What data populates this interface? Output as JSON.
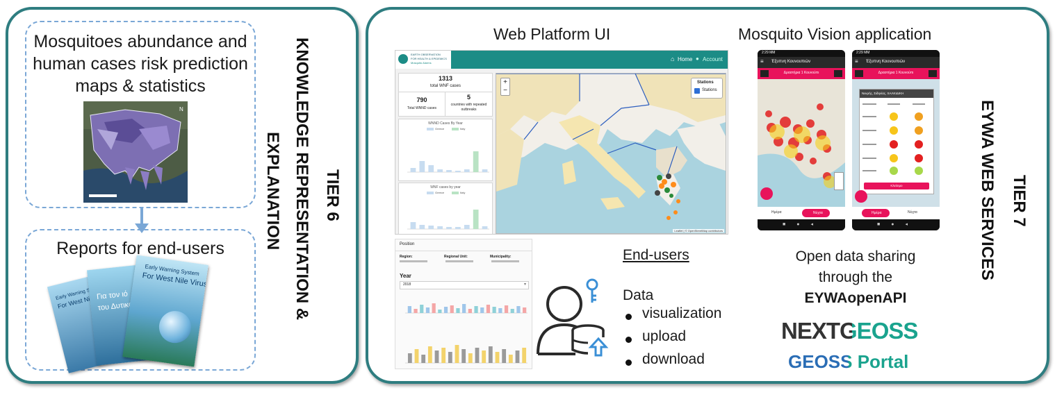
{
  "tier6": {
    "tier_label": "TIER 6",
    "title_line1": "KNOWLEDGE REPRESENTATION &",
    "title_line2": "EXPLANATION",
    "maps_box": {
      "line1": "Mosquitoes abundance and",
      "line2": "human cases risk prediction",
      "line3": "maps & statistics"
    },
    "reports_box": {
      "title": "Reports for end-users",
      "brochure_front_title_1": "Early Warning System",
      "brochure_front_title_2": "For West Nile Virus",
      "brochure_mid_title_1": "Για τον ιό",
      "brochure_mid_title_2": "του Δυτικού",
      "brochure_back_title": "For West Nile"
    }
  },
  "tier7": {
    "tier_label": "TIER 7",
    "title": "EYWA WEB SERVICES",
    "web_platform_title": "Web Platform UI",
    "mosquito_vision_title": "Mosquito Vision application",
    "end_users_title": "End-users",
    "data_label": "Data",
    "data_items": [
      "visualization",
      "upload",
      "download"
    ],
    "open_data_line1": "Open data sharing",
    "open_data_line2": "through the",
    "open_data_line3": "EYWAopenAPI",
    "nextgeoss_logo": "NEXTGEOSS",
    "geoss_portal_logo": "GEOSS Portal"
  },
  "web_ui": {
    "logo_line1": "EARTH OBSERVATION",
    "logo_line2": "FOR HEALTH & EPIDEMICS",
    "logo_line3": "Mosquito Alarms",
    "nav_home": "Home",
    "nav_account": "Account",
    "stat_total_wnf_value": "1313",
    "stat_total_wnf_label": "total WNF cases",
    "stat_total_wnnd_value": "790",
    "stat_total_wnnd_label": "Total WNND cases",
    "stat_countries_value": "5",
    "stat_countries_label_1": "countries with repeated",
    "stat_countries_label_2": "outbreaks",
    "chart1_title": "WNND Cases By Year",
    "chart2_title": "WNF cases by year",
    "legend_greece": "Greece",
    "legend_italy": "Italy",
    "map_stations_title": "Stations",
    "map_stations_option": "Stations",
    "map_attribution": "Leaflet | © OpenStreetMap contributors",
    "zoom_in": "+",
    "zoom_out": "−",
    "details_panel_title": "Position",
    "details_region_label": "Region:",
    "details_regional_unit_label": "Regional Unit:",
    "details_municipality_label": "Municipality:",
    "year_label": "Year",
    "year_value": "2018"
  },
  "phones": {
    "left_header": "Έξυπνη Κουνουπιών",
    "right_header": "Έξυπνη Κουνουπιών",
    "left_banner": "Δραστήρια 1 Κουνούπι",
    "right_banner": "Δραστήρια 1 Κουνούπι",
    "right_popup_title": "Νεκρής, Σιδηνίας, ΧΑΛΚΙΔΙΚΗ",
    "right_button": "Κλείσιμο",
    "tab_day": "Ημέρα",
    "tab_night": "Νύχτα",
    "left_time": "2:29 ΜΜ",
    "right_time": "2:29 ΜΜ"
  },
  "colors": {
    "panel_border": "#2e7d80",
    "dash_border": "#7aa7d6",
    "web_header": "#1c8c86",
    "phone_accent": "#e8135b",
    "geoss_blue": "#2a6db5",
    "next_teal": "#1aa38e"
  }
}
